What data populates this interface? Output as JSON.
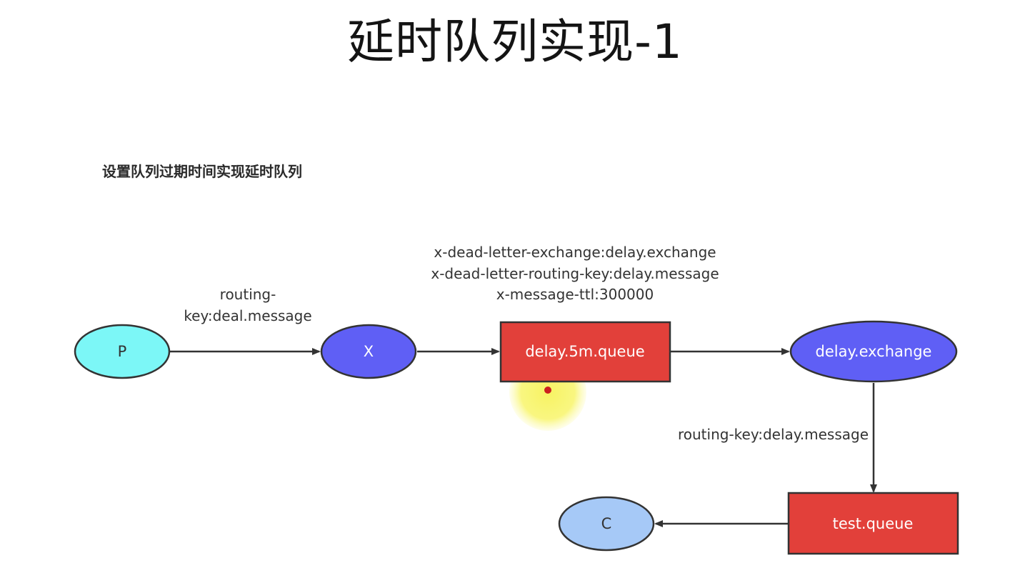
{
  "title": "延时队列实现-1",
  "subtitle": "设置队列过期时间实现延时队列",
  "nodes": {
    "p": "P",
    "x": "X",
    "delay_queue": "delay.5m.queue",
    "delay_exchange": "delay.exchange",
    "test_queue": "test.queue",
    "c": "C"
  },
  "edge_labels": {
    "p_to_x_line1": "routing-",
    "p_to_x_line2": "key:deal.message",
    "queue_args_line1": "x-dead-letter-exchange:delay.exchange",
    "queue_args_line2": "x-dead-letter-routing-key:delay.message",
    "queue_args_line3": "x-message-ttl:300000",
    "exchange_to_test": "routing-key:delay.message"
  },
  "colors": {
    "producer": "#7cf7f7",
    "exchange": "#5f5ff5",
    "queue": "#e2403a",
    "consumer": "#a6c9f7",
    "edge": "#333333",
    "cursor_highlight": "#f8f56a"
  }
}
